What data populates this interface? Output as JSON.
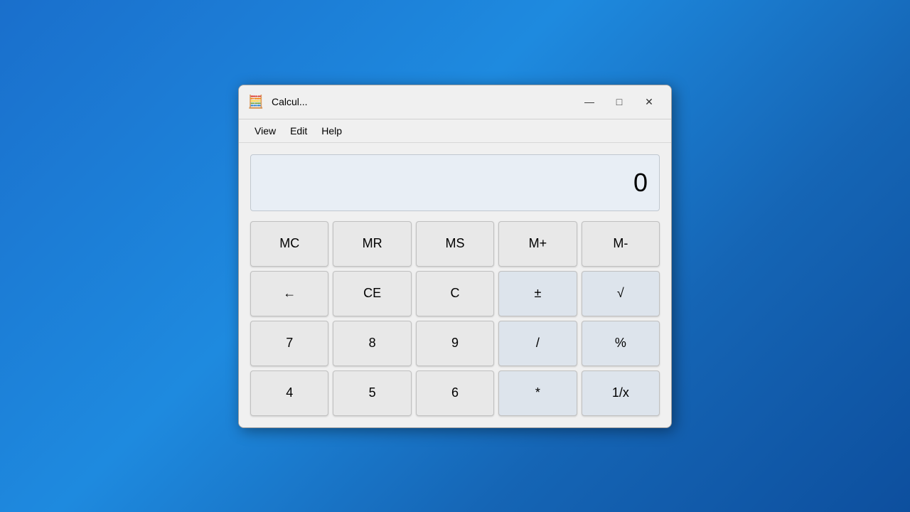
{
  "window": {
    "title": "Calcul...",
    "icon": "🧮"
  },
  "titlebar": {
    "minimize_label": "—",
    "maximize_label": "□",
    "close_label": "✕"
  },
  "menubar": {
    "items": [
      {
        "label": "View",
        "id": "view"
      },
      {
        "label": "Edit",
        "id": "edit"
      },
      {
        "label": "Help",
        "id": "help"
      }
    ]
  },
  "display": {
    "value": "0"
  },
  "buttons": {
    "row1": [
      {
        "label": "MC",
        "id": "mc",
        "type": "memory"
      },
      {
        "label": "MR",
        "id": "mr",
        "type": "memory"
      },
      {
        "label": "MS",
        "id": "ms",
        "type": "memory"
      },
      {
        "label": "M+",
        "id": "mplus",
        "type": "memory"
      },
      {
        "label": "M-",
        "id": "mminus",
        "type": "memory"
      }
    ],
    "row2": [
      {
        "label": "←",
        "id": "backspace",
        "type": "control"
      },
      {
        "label": "CE",
        "id": "ce",
        "type": "control"
      },
      {
        "label": "C",
        "id": "c",
        "type": "control"
      },
      {
        "label": "±",
        "id": "plusminus",
        "type": "operator"
      },
      {
        "label": "√",
        "id": "sqrt",
        "type": "operator"
      }
    ],
    "row3": [
      {
        "label": "7",
        "id": "7",
        "type": "digit"
      },
      {
        "label": "8",
        "id": "8",
        "type": "digit"
      },
      {
        "label": "9",
        "id": "9",
        "type": "digit"
      },
      {
        "label": "/",
        "id": "divide",
        "type": "operator"
      },
      {
        "label": "%",
        "id": "percent",
        "type": "operator"
      }
    ],
    "row4": [
      {
        "label": "4",
        "id": "4",
        "type": "digit"
      },
      {
        "label": "5",
        "id": "5",
        "type": "digit"
      },
      {
        "label": "6",
        "id": "6",
        "type": "digit"
      },
      {
        "label": "*",
        "id": "multiply",
        "type": "operator"
      },
      {
        "label": "1/x",
        "id": "reciprocal",
        "type": "operator"
      }
    ]
  }
}
